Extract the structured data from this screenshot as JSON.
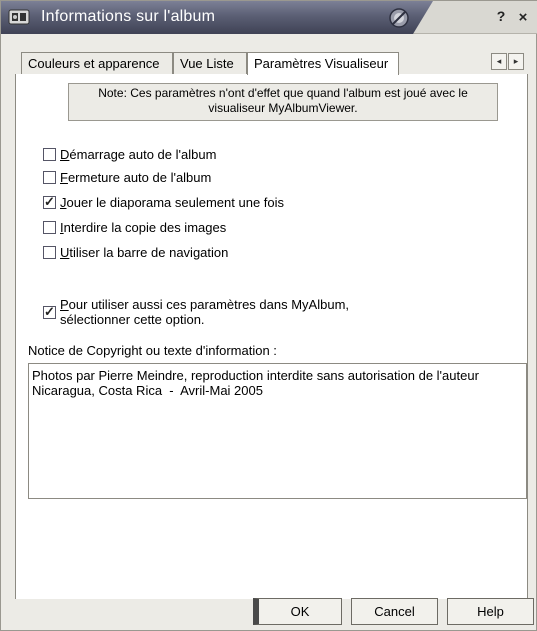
{
  "window": {
    "title": "Informations sur l'album",
    "help_label": "?",
    "close_label": "×",
    "colors": {
      "title_bar": "#5b5f74",
      "panel": "#ffffff",
      "frame": "#ecebe6"
    }
  },
  "tabs": [
    {
      "label": "Couleurs et apparence",
      "active": false
    },
    {
      "label": "Vue Liste",
      "active": false
    },
    {
      "label": "Paramètres Visualiseur",
      "active": true
    }
  ],
  "tab_scroll": {
    "left": "◂",
    "right": "▸"
  },
  "note": {
    "line1": "Note: Ces paramètres n'ont d'effet que quand l'album est joué avec le",
    "line2": "visualiseur MyAlbumViewer."
  },
  "options": [
    {
      "mnemonic": "D",
      "rest": "émarrage auto de l'album",
      "checked": false
    },
    {
      "mnemonic": "F",
      "rest": "ermeture auto de l'album",
      "checked": false
    },
    {
      "mnemonic": "J",
      "rest": "ouer le diaporama seulement une fois",
      "checked": true
    },
    {
      "mnemonic": "I",
      "rest": "nterdire la copie des images",
      "checked": false
    },
    {
      "mnemonic": "U",
      "rest": "tiliser la barre de navigation",
      "checked": false
    }
  ],
  "myalbum_option": {
    "mnemonic": "P",
    "line1_rest": "our utiliser aussi ces paramètres dans MyAlbum,",
    "line2": "sélectionner cette option.",
    "checked": true
  },
  "notice": {
    "label": "Notice de Copyright ou texte d'information :",
    "text": "Photos par Pierre Meindre, reproduction interdite sans autorisation de l'auteur\nNicaragua, Costa Rica  -  Avril-Mai 2005"
  },
  "buttons": {
    "ok": "OK",
    "cancel": "Cancel",
    "help": "Help"
  }
}
